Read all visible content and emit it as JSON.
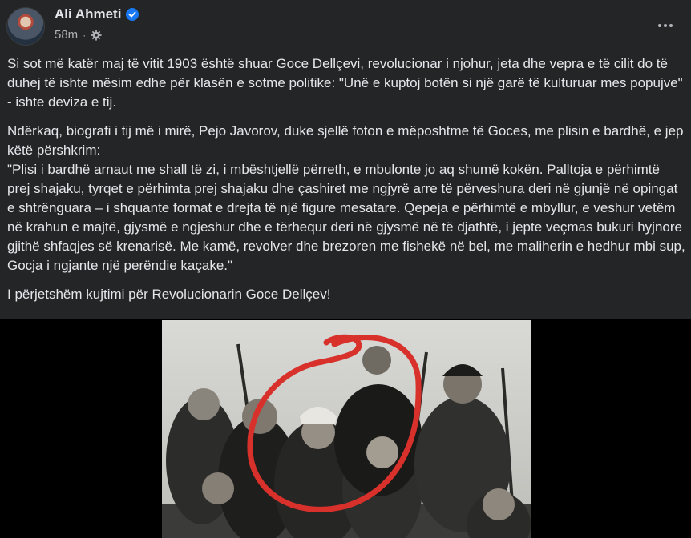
{
  "post": {
    "author": "Ali Ahmeti",
    "timestamp": "58m",
    "paragraphs": [
      "Si sot më katër maj të vitit 1903 është shuar Goce Dellçevi, revolucionar i njohur, jeta dhe vepra e të cilit do të duhej të ishte mësim edhe për klasën e sotme politike: \"Unë e kuptoj botën si një garë të kulturuar mes popujve\" - ishte deviza e tij.",
      "Ndërkaq, biografi i tij më i mirë, Pejo Javorov, duke sjellë foton e mëposhtme të Goces, me plisin e bardhë, e jep  këtë përshkrim:\n\"Plisi i bardhë arnaut me shall të zi, i mbështjellë përreth, e mbulonte jo aq shumë kokën. Palltoja e përhimtë prej shajaku, tyrqet e përhimta prej shajaku dhe çashiret me ngjyrë arre të përveshura deri në gjunjë në opingat e shtrënguara – i shquante format e drejta të një figure mesatare. Qepeja e përhimtë e mbyllur, e veshur vetëm në krahun e majtë, gjysmë e ngjeshur dhe e tërhequr deri në gjysmë në të djathtë, i jepte veçmas bukuri hyjnore gjithë shfaqjes së krenarisë. Me kamë, revolver dhe brezoren me fishekë në bel, me maliherin e hedhur mbi sup, Gocja i ngjante një perëndie kaçake.\"",
      "I përjetshëm kujtimi për Revolucionarin Goce Dellçev!"
    ]
  },
  "colors": {
    "background": "#242526",
    "text": "#e4e6eb",
    "secondary": "#b0b3b8",
    "verified": "#1877f2",
    "circle": "#d8302a"
  },
  "icons": {
    "verified": "verified-badge-icon",
    "privacy": "gear-icon",
    "more": "more-horizontal-icon"
  }
}
